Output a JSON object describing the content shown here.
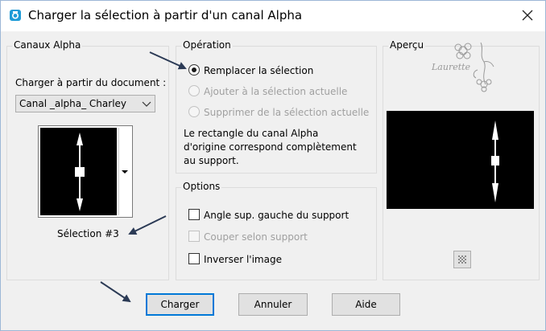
{
  "window": {
    "title": "Charger la sélection à partir d'un canal Alpha"
  },
  "alpha_channels": {
    "group_label": "Canaux Alpha",
    "load_from_label": "Charger à partir du document :",
    "document_value": "Canal _alpha_ Charley",
    "selection_name": "Sélection #3"
  },
  "operation": {
    "group_label": "Opération",
    "options": [
      {
        "label": "Remplacer la sélection",
        "checked": true,
        "enabled": true
      },
      {
        "label": "Ajouter à la sélection actuelle",
        "checked": false,
        "enabled": false
      },
      {
        "label": "Supprimer de la sélection actuelle",
        "checked": false,
        "enabled": false
      }
    ],
    "description": "Le rectangle du canal Alpha\nd'origine correspond complètement\nau support."
  },
  "options": {
    "group_label": "Options",
    "items": [
      {
        "label": "Angle sup. gauche du support",
        "checked": false,
        "enabled": true
      },
      {
        "label": "Couper selon support",
        "checked": false,
        "enabled": false
      },
      {
        "label": "Inverser l'image",
        "checked": false,
        "enabled": true
      }
    ]
  },
  "preview": {
    "group_label": "Aperçu",
    "watermark": "Laurette"
  },
  "buttons": {
    "load": "Charger",
    "cancel": "Annuler",
    "help": "Aide"
  }
}
